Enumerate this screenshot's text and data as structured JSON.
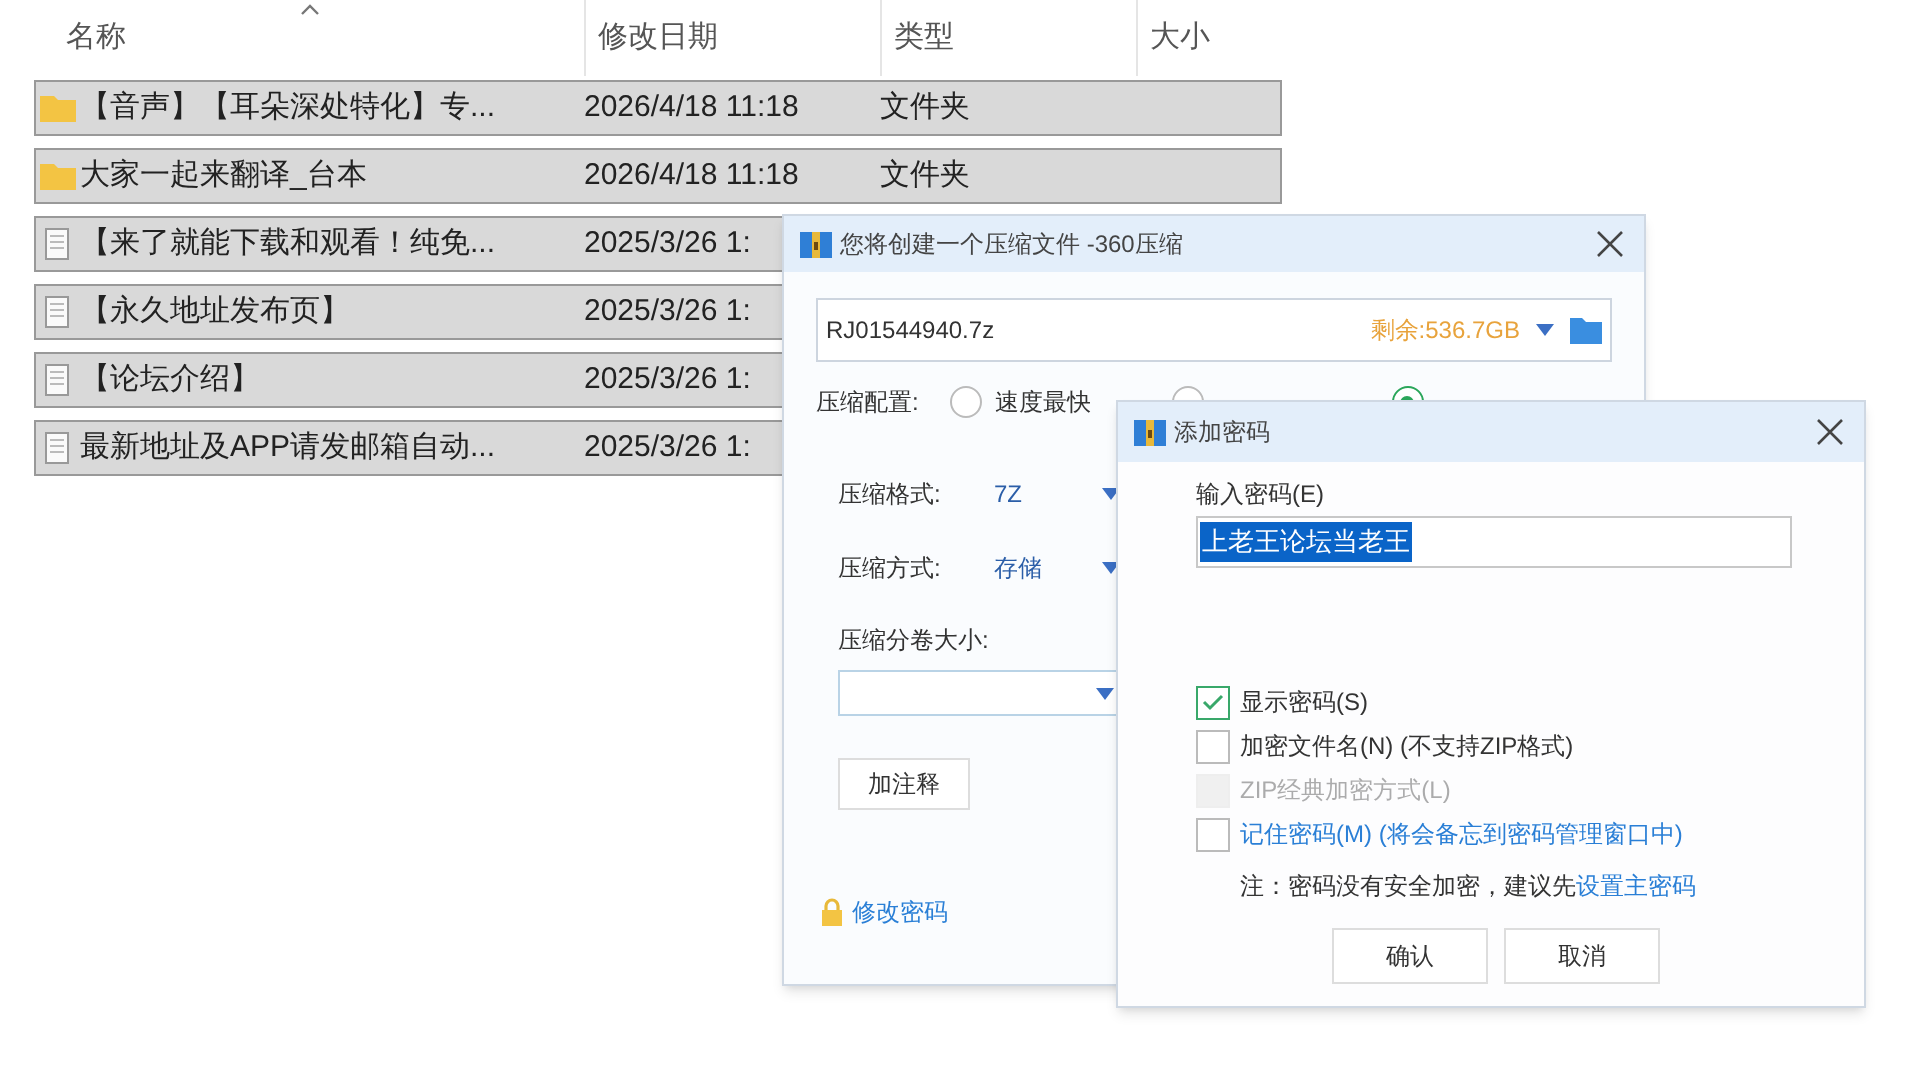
{
  "explorer": {
    "columns": [
      {
        "label": "名称",
        "sorted": true
      },
      {
        "label": "修改日期",
        "sorted": false
      },
      {
        "label": "类型",
        "sorted": false
      },
      {
        "label": "大小",
        "sorted": false
      }
    ],
    "rows": [
      {
        "kind": "folder",
        "name": "【音声】【耳朵深处特化】专...",
        "date": "2026/4/18 11:18",
        "type": "文件夹",
        "selected": true
      },
      {
        "kind": "folder",
        "name": "大家一起来翻译_台本",
        "date": "2026/4/18 11:18",
        "type": "文件夹",
        "selected": true
      },
      {
        "kind": "file",
        "name": "【来了就能下载和观看！纯免...",
        "date": "2025/3/26 1:",
        "selected": true
      },
      {
        "kind": "file",
        "name": "【永久地址发布页】",
        "date": "2025/3/26 1:",
        "selected": true
      },
      {
        "kind": "file",
        "name": "【论坛介绍】",
        "date": "2025/3/26 1:",
        "selected": true
      },
      {
        "kind": "file",
        "name": "最新地址及APP请发邮箱自动...",
        "date": "2025/3/26 1:",
        "selected": true
      }
    ]
  },
  "compress_dialog": {
    "title": "您将创建一个压缩文件 -360压缩",
    "filename": "RJ01544940.7z",
    "free_space": "剩余:536.7GB",
    "config_label": "压缩配置:",
    "options": [
      {
        "label": "速度最快",
        "selected": false
      },
      {
        "selected": false
      },
      {
        "selected": true
      }
    ],
    "format": {
      "label": "压缩格式:",
      "value": "7Z"
    },
    "method": {
      "label": "压缩方式:",
      "value": "存储"
    },
    "volume_label": "压缩分卷大小:",
    "comment_button": "加注释",
    "password_link": "修改密码"
  },
  "password_dialog": {
    "title": "添加密码",
    "password_label": "输入密码(E)",
    "password": {
      "value": "上老王论坛当老王",
      "selected": true
    },
    "checkboxes": [
      {
        "kind": "plain",
        "label": "显示密码(S)",
        "checked": true,
        "disabled": false
      },
      {
        "kind": "plain",
        "label": "加密文件名(N) (不支持ZIP格式)",
        "checked": false,
        "disabled": false
      },
      {
        "kind": "plain",
        "label": "ZIP经典加密方式(L)",
        "checked": false,
        "disabled": true
      },
      {
        "kind": "link",
        "label": "记住密码(M) (将会备忘到密码管理窗口中)",
        "checked": false,
        "disabled": false
      }
    ],
    "note": "注：密码没有安全加密，建议先",
    "note_link": "设置主密码",
    "buttons": [
      "确认",
      "取消"
    ]
  }
}
